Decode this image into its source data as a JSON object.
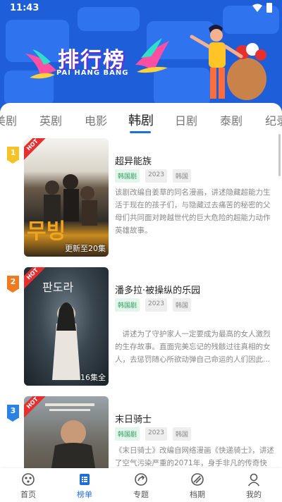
{
  "status_bar": {
    "time": "11:43"
  },
  "banner": {
    "title": "排行榜",
    "subtitle": "PAI HANG BANG"
  },
  "tabs": [
    {
      "label": "美剧"
    },
    {
      "label": "英剧"
    },
    {
      "label": "电影"
    },
    {
      "label": "韩剧"
    },
    {
      "label": "日剧"
    },
    {
      "label": "泰剧"
    },
    {
      "label": "纪录"
    }
  ],
  "active_tab": "韩剧",
  "items": [
    {
      "rank": "1",
      "hot_badge": "HOT",
      "poster_episode": "更新至20集",
      "poster_title_art": "무빙",
      "name": "超异能族",
      "tags": [
        "韩国剧",
        "2023",
        "韩国"
      ],
      "description": "该剧改编自姜草的同名漫画，讲述隐藏超能力生活于现在的孩子们，与隐藏过去痛苦的秘密的父母们共同面对跨越世代的巨大危险的超能力动作英雄故事。"
    },
    {
      "rank": "2",
      "hot_badge": "HOT",
      "poster_episode": "16集全",
      "poster_title_art": "판도라",
      "name": "潘多拉·被操纵的乐园",
      "tags": [
        "韩国剧",
        "2023",
        "韩国"
      ],
      "description": "　讲述为了守护家人一定要成为最高的女人激烈的生存故事。直面完美忘记的残骸过往真相的女人，去惩罚随心所欲动弹自己命运的人们因此..."
    },
    {
      "rank": "3",
      "hot_badge": "HOT",
      "poster_episode": "",
      "poster_title_art": "",
      "name": "末日骑士",
      "tags": [
        "韩国剧",
        "2023",
        "韩国"
      ],
      "description": "《末日骑士》改编自网络漫画《快递骑士》，讲述了空气污染严重的2071年，身手非凡的传奇快"
    }
  ],
  "bottom_nav": [
    {
      "label": "首页",
      "icon": "home-icon"
    },
    {
      "label": "榜单",
      "icon": "list-icon"
    },
    {
      "label": "专题",
      "icon": "topic-icon"
    },
    {
      "label": "档期",
      "icon": "schedule-icon"
    },
    {
      "label": "我的",
      "icon": "profile-icon"
    }
  ],
  "active_nav": "榜单",
  "colors": {
    "banner_blue": "#1e5ed8",
    "accent_blue": "#1e6fd9",
    "tag_green": "#2e9d5d",
    "hot_red": "#e63030"
  }
}
